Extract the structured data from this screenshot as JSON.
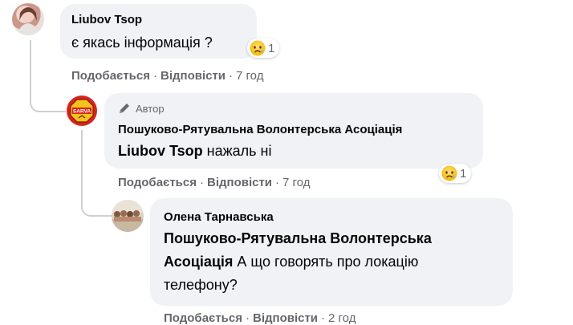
{
  "comments": [
    {
      "author": "Liubov Tsop",
      "text": "є якась інформація ?",
      "reaction": {
        "icon": "sad-emoji-icon",
        "count": "1"
      },
      "actions": {
        "like": "Подобається",
        "reply": "Відповісти",
        "time": "7 год"
      }
    },
    {
      "author_tag": "Автор",
      "author": "Пошуково-Рятувальна Волонтерська Асоціація",
      "mention": "Liubov Tsop",
      "text": " нажаль ні",
      "avatar_text": "SARVA",
      "reaction": {
        "icon": "sad-emoji-icon",
        "count": "1"
      },
      "actions": {
        "like": "Подобається",
        "reply": "Відповісти",
        "time": "7 год"
      }
    },
    {
      "author": "Олена Тарнавська",
      "mention_line1": "Пошуково-Рятувальна Волонтерська",
      "mention_line2": "Асоціація",
      "text_line2": " А що говорять про локацію",
      "text_line3": "телефону?",
      "actions": {
        "like": "Подобається",
        "reply": "Відповісти",
        "time": "2 год"
      }
    }
  ],
  "separator": "·"
}
